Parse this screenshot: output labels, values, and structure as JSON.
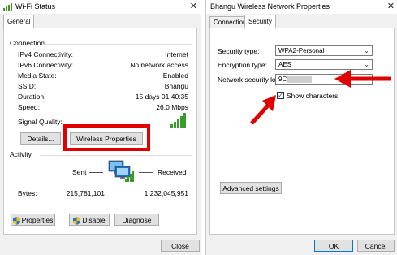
{
  "wifi_status": {
    "title": "Wi-Fi Status",
    "tab": "General",
    "connection": {
      "header": "Connection",
      "rows": [
        {
          "label": "IPv4 Connectivity:",
          "value": "Internet"
        },
        {
          "label": "IPv6 Connectivity:",
          "value": "No network access"
        },
        {
          "label": "Media State:",
          "value": "Enabled"
        },
        {
          "label": "SSID:",
          "value": "Bhangu"
        },
        {
          "label": "Duration:",
          "value": "15 days 01:40:35"
        },
        {
          "label": "Speed:",
          "value": "26.0 Mbps"
        }
      ],
      "signal_quality_label": "Signal Quality:"
    },
    "buttons": {
      "details": "Details...",
      "wireless_properties": "Wireless Properties",
      "properties": "Properties",
      "disable": "Disable",
      "diagnose": "Diagnose",
      "close": "Close"
    },
    "activity": {
      "header": "Activity",
      "sent_label": "Sent",
      "received_label": "Received",
      "bytes_label": "Bytes:",
      "bytes_sent": "215,781,101",
      "bytes_received": "1,232,045,951"
    }
  },
  "net_props": {
    "title": "Bhangu Wireless Network Properties",
    "tabs": [
      "Connection",
      "Security"
    ],
    "active_tab": "Security",
    "security_type_label": "Security type:",
    "security_type_value": "WPA2-Personal",
    "encryption_type_label": "Encryption type:",
    "encryption_type_value": "AES",
    "network_key_label": "Network security key",
    "network_key_visible_prefix": "9C",
    "show_characters_label": "Show characters",
    "show_characters_checked": true,
    "advanced_settings": "Advanced settings",
    "ok": "OK",
    "cancel": "Cancel"
  },
  "colors": {
    "highlight_red": "#e10000",
    "signal_green": "#3a9a2a",
    "accent_blue": "#0078d7"
  }
}
